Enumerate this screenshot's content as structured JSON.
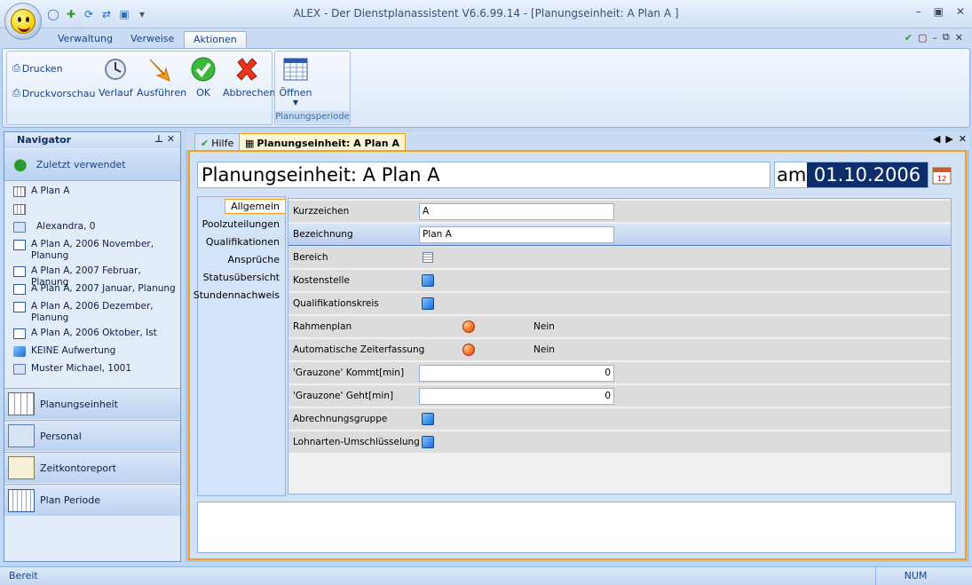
{
  "window": {
    "title": "ALEX - Der Dienstplanassistent V6.6.99.14 - [Planungseinheit: A Plan A ]"
  },
  "ribbon": {
    "tabs": [
      "Verwaltung",
      "Verweise",
      "Aktionen"
    ],
    "active_tab": "Aktionen",
    "print": "Drucken",
    "preview": "Druckvorschau",
    "history": "Verlauf",
    "execute": "Ausführen",
    "ok": "OK",
    "cancel": "Abbrechen",
    "open": "Öffnen",
    "group_label": "Planungsperiode"
  },
  "navigator": {
    "title": "Navigator",
    "recent": "Zuletzt verwendet",
    "items": [
      {
        "label": "A Plan A",
        "icon": "grid-icon"
      },
      {
        "label": "",
        "icon": "grid-icon"
      },
      {
        "label": "Alexandra, 0",
        "icon": "person-card-icon"
      },
      {
        "label": "A Plan A, 2006 November, Planung",
        "icon": "calendar-icon"
      },
      {
        "label": "A Plan A, 2007 Februar, Planung",
        "icon": "calendar-icon"
      },
      {
        "label": "A Plan A, 2007 Januar, Planung",
        "icon": "calendar-icon"
      },
      {
        "label": "A Plan A, 2006 Dezember, Planung",
        "icon": "calendar-icon"
      },
      {
        "label": "A Plan A, 2006 Oktober, Ist",
        "icon": "calendar-icon"
      },
      {
        "label": "KEINE Aufwertung",
        "icon": "cube-icon"
      },
      {
        "label": "Muster Michael, 1001",
        "icon": "person-card-icon"
      }
    ],
    "sections": [
      "Planungseinheit",
      "Personal",
      "Zeitkontoreport",
      "Plan Periode"
    ]
  },
  "doc": {
    "tab_help": "Hilfe",
    "tab_active": "Planungseinheit: A Plan A",
    "heading": "Planungseinheit: A Plan A",
    "am": "am",
    "date": "01.10.2006",
    "subtabs": [
      "Allgemein",
      "Poolzuteilungen",
      "Qualifikationen",
      "Ansprüche",
      "Statusübersicht",
      "Stundennachweis"
    ],
    "fields": {
      "kurzzeichen": {
        "label": "Kurzzeichen",
        "value": "A"
      },
      "bezeichnung": {
        "label": "Bezeichnung",
        "value": "Plan A"
      },
      "bereich": "Bereich",
      "kostenstelle": "Kostenstelle",
      "qualikreis": "Qualifikationskreis",
      "rahmenplan": {
        "label": "Rahmenplan",
        "value": "Nein"
      },
      "zeiterfassung": {
        "label": "Automatische Zeiterfassung",
        "value": "Nein"
      },
      "kommt": {
        "label": "'Grauzone' Kommt[min]",
        "value": "0"
      },
      "geht": {
        "label": "'Grauzone' Geht[min]",
        "value": "0"
      },
      "abrechnung": "Abrechnungsgruppe",
      "lohnarten": "Lohnarten-Umschlüsselung"
    }
  },
  "status": {
    "left": "Bereit",
    "num": "NUM"
  }
}
